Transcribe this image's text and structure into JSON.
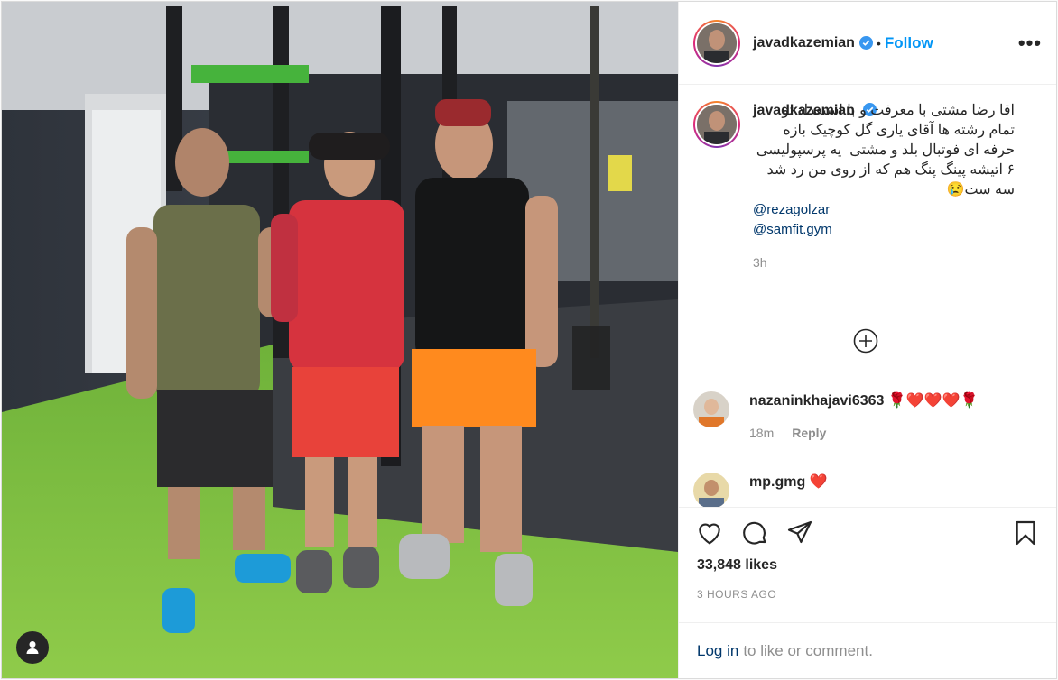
{
  "post": {
    "username": "javadkazemian",
    "verified": true,
    "follow_label": "Follow",
    "separator": "•",
    "more_label": "•••",
    "caption_text": "اقا رضا مشتی با معرفت و با استعداد تو تمام رشته ها آقای یاری گل کوچیک بازه حرفه ای فوتبال بلد و مشتی  یه پرسپولیسی ۶ اتیشه پینگ پنگ هم که از روی من رد شد سه ست😢",
    "mentions": [
      "@rezagolzar",
      "@samfit.gym"
    ],
    "caption_time": "3h",
    "comments": [
      {
        "username": "nazaninkhajavi6363",
        "text": "🌹❤️❤️❤️🌹",
        "time": "18m",
        "reply": "Reply"
      },
      {
        "username": "mp.gmg",
        "text": "❤️"
      }
    ],
    "likes": "33,848 likes",
    "timestamp": "3 HOURS AGO",
    "login_link": "Log in",
    "login_rest": "to like or comment.",
    "colors": {
      "accent": "#0095f6",
      "link": "#00376b",
      "muted": "#8e8e8e"
    }
  }
}
